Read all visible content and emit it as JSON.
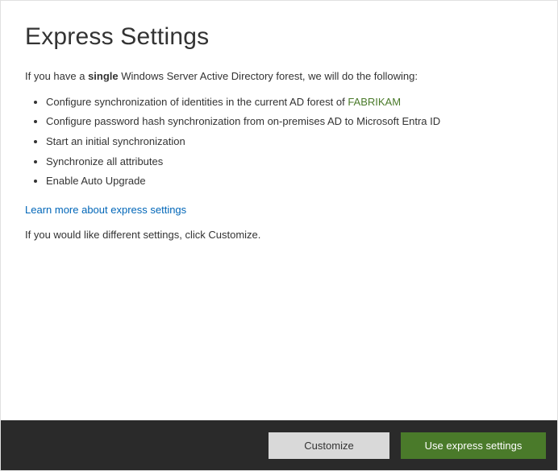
{
  "title": "Express Settings",
  "intro_prefix": "If you have a ",
  "intro_bold": "single",
  "intro_suffix": " Windows Server Active Directory forest, we will do the following:",
  "bullets": {
    "b0_prefix": "Configure synchronization of identities in the current AD forest of ",
    "b0_forest": "FABRIKAM",
    "b1": "Configure password hash synchronization from on-premises AD to Microsoft Entra ID",
    "b2": "Start an initial synchronization",
    "b3": "Synchronize all attributes",
    "b4": "Enable Auto Upgrade"
  },
  "learn_more": "Learn more about express settings",
  "footnote": "If you would like different settings, click Customize.",
  "buttons": {
    "customize": "Customize",
    "express": "Use express settings"
  }
}
